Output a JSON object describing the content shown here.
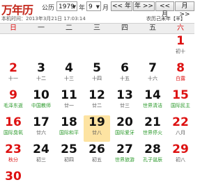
{
  "header": {
    "brand": "万年历",
    "calendar_label": "公历",
    "year_value": "1979",
    "year_label": "年",
    "month_value": "9",
    "month_label": "月",
    "prev_year_button": "<< 年",
    "next_year_button": "年 >>",
    "prev_month_button": "<< 月",
    "next_month_button": "月 >>"
  },
  "info": {
    "local_time": "本机时间：2013年3月21日 17:03:14",
    "lunar_year": "农历己未年【羊】"
  },
  "weekdays": [
    "日",
    "一",
    "二",
    "三",
    "四",
    "五",
    "六"
  ],
  "days": [
    {
      "num": "1",
      "sub": "初十",
      "weekend": true
    },
    {
      "num": "2",
      "sub": "十一",
      "weekend": true
    },
    {
      "num": "3",
      "sub": "十二",
      "weekend": false
    },
    {
      "num": "4",
      "sub": "十三",
      "weekend": false
    },
    {
      "num": "5",
      "sub": "十四",
      "weekend": false
    },
    {
      "num": "6",
      "sub": "十五",
      "weekend": false
    },
    {
      "num": "7",
      "sub": "十六",
      "weekend": false
    },
    {
      "num": "8",
      "sub": "白露",
      "weekend": true,
      "type": "fest"
    },
    {
      "num": "9",
      "sub": "毛泽东逝",
      "weekend": true,
      "type": "hol"
    },
    {
      "num": "10",
      "sub": "中国教师",
      "weekend": false,
      "type": "hol"
    },
    {
      "num": "11",
      "sub": "廿一",
      "weekend": false
    },
    {
      "num": "12",
      "sub": "廿二",
      "weekend": false
    },
    {
      "num": "13",
      "sub": "廿三",
      "weekend": false
    },
    {
      "num": "14",
      "sub": "世界清洁",
      "weekend": false,
      "type": "hol"
    },
    {
      "num": "15",
      "sub": "国际民主",
      "weekend": true,
      "type": "hol"
    },
    {
      "num": "16",
      "sub": "国际臭氧",
      "weekend": true,
      "type": "hol"
    },
    {
      "num": "17",
      "sub": "廿六",
      "weekend": false
    },
    {
      "num": "18",
      "sub": "国际和平",
      "weekend": false,
      "type": "hol"
    },
    {
      "num": "19",
      "sub": "廿八",
      "weekend": false,
      "today": true
    },
    {
      "num": "20",
      "sub": "国际爱牙",
      "weekend": false,
      "type": "hol"
    },
    {
      "num": "21",
      "sub": "世界停火",
      "weekend": false,
      "type": "hol"
    },
    {
      "num": "22",
      "sub": "八月",
      "weekend": true
    },
    {
      "num": "23",
      "sub": "秋分",
      "weekend": true,
      "type": "fest"
    },
    {
      "num": "24",
      "sub": "初三",
      "weekend": false
    },
    {
      "num": "25",
      "sub": "初四",
      "weekend": false
    },
    {
      "num": "26",
      "sub": "初五",
      "weekend": false
    },
    {
      "num": "27",
      "sub": "世界旅游",
      "weekend": false,
      "type": "hol"
    },
    {
      "num": "28",
      "sub": "孔子诞辰",
      "weekend": false,
      "type": "hol"
    },
    {
      "num": "29",
      "sub": "初八",
      "weekend": true
    },
    {
      "num": "30",
      "sub": "",
      "weekend": true
    }
  ]
}
